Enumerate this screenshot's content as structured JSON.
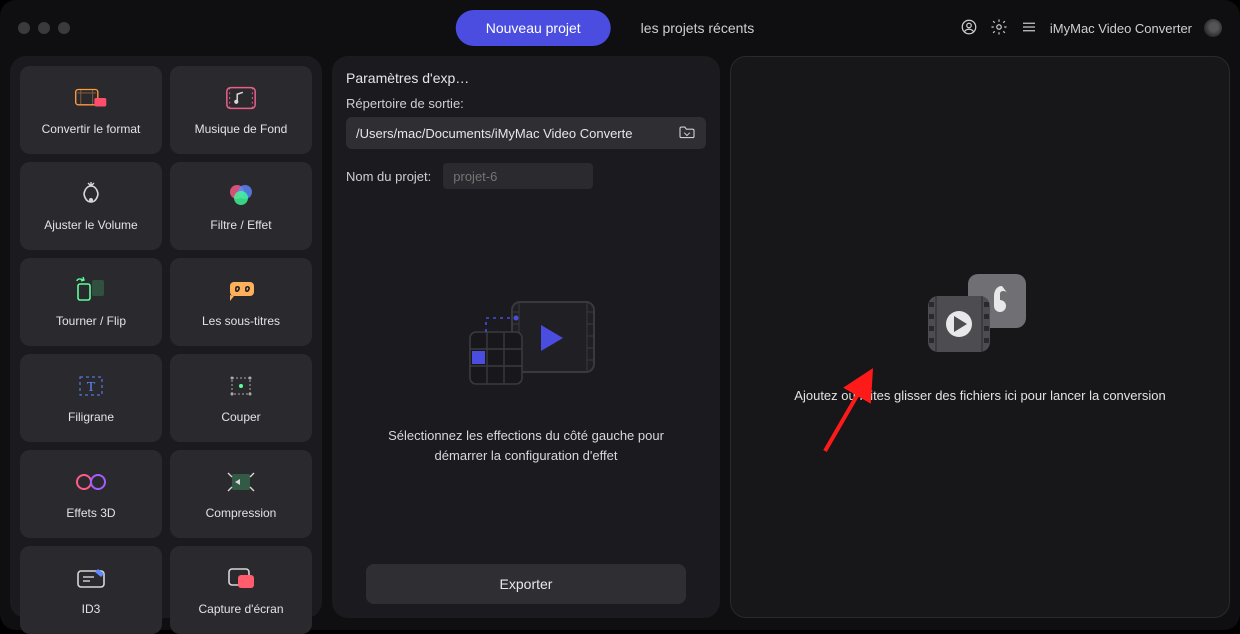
{
  "app": {
    "title": "iMyMac Video Converter"
  },
  "tabs": {
    "new_project": "Nouveau projet",
    "recent_projects": "les projets récents"
  },
  "sidebar": {
    "tools": [
      {
        "id": "convert-format",
        "label": "Convertir le format"
      },
      {
        "id": "background-music",
        "label": "Musique de Fond"
      },
      {
        "id": "adjust-volume",
        "label": "Ajuster le Volume"
      },
      {
        "id": "filter-effect",
        "label": "Filtre / Effet"
      },
      {
        "id": "rotate-flip",
        "label": "Tourner / Flip"
      },
      {
        "id": "subtitles",
        "label": "Les sous-titres"
      },
      {
        "id": "watermark",
        "label": "Filigrane"
      },
      {
        "id": "cut",
        "label": "Couper"
      },
      {
        "id": "effects-3d",
        "label": "Effets 3D"
      },
      {
        "id": "compression",
        "label": "Compression"
      },
      {
        "id": "id3",
        "label": "ID3"
      },
      {
        "id": "screen-capture",
        "label": "Capture d'écran"
      }
    ]
  },
  "middle": {
    "heading": "Paramètres d'exp…",
    "output_label": "Répertoire de sortie:",
    "output_path": "/Users/mac/Documents/iMyMac Video Converte",
    "project_name_label": "Nom du projet:",
    "project_name_placeholder": "projet-6",
    "center_caption": "Sélectionnez les effections du côté gauche pour démarrer la configuration d'effet",
    "export_button": "Exporter"
  },
  "right": {
    "caption": "Ajoutez ou faites glisser des fichiers ici pour lancer la conversion"
  },
  "colors": {
    "accent": "#4a4de0",
    "panel": "#1b1b1f",
    "tile": "#2a2a2e"
  }
}
